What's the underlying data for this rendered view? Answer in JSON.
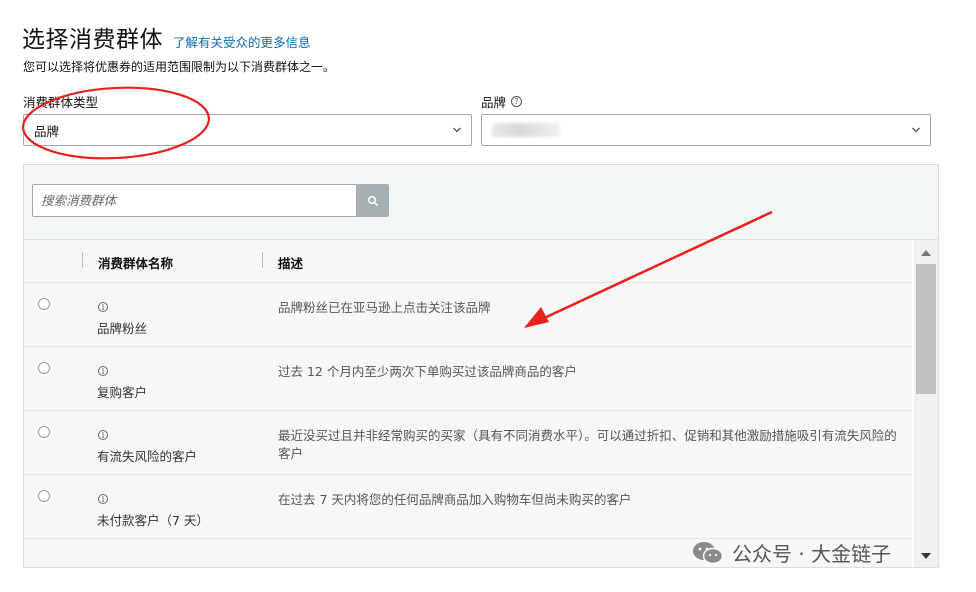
{
  "header": {
    "title": "选择消费群体",
    "info_link": "了解有关受众的更多信息",
    "subtitle": "您可以选择将优惠券的适用范围限制为以下消费群体之一。"
  },
  "fields": {
    "audience_type": {
      "label": "消费群体类型",
      "value": "品牌"
    },
    "brand": {
      "label": "品牌",
      "value": ""
    }
  },
  "search": {
    "placeholder": "搜索消费群体"
  },
  "table": {
    "columns": [
      "消费群体名称",
      "描述"
    ],
    "rows": [
      {
        "name": "品牌粉丝",
        "description": "品牌粉丝已在亚马逊上点击关注该品牌"
      },
      {
        "name": "复购客户",
        "description": "过去 12 个月内至少两次下单购买过该品牌商品的客户"
      },
      {
        "name": "有流失风险的客户",
        "description": "最近没买过且并非经常购买的买家（具有不同消费水平）。可以通过折扣、促销和其他激励措施吸引有流失风险的客户"
      },
      {
        "name": "未付款客户（7 天）",
        "description": "在过去 7 天内将您的任何品牌商品加入购物车但尚未购买的客户"
      }
    ]
  },
  "watermark": {
    "text": "公众号 · 大金链子"
  },
  "icons": {
    "info": "info-icon",
    "search": "search-icon",
    "help": "help-icon",
    "dropdown": "chevron-down-icon"
  },
  "colors": {
    "link": "#0a6eb4",
    "annotation": "#e8211c",
    "search_button": "#a6b0b3"
  }
}
